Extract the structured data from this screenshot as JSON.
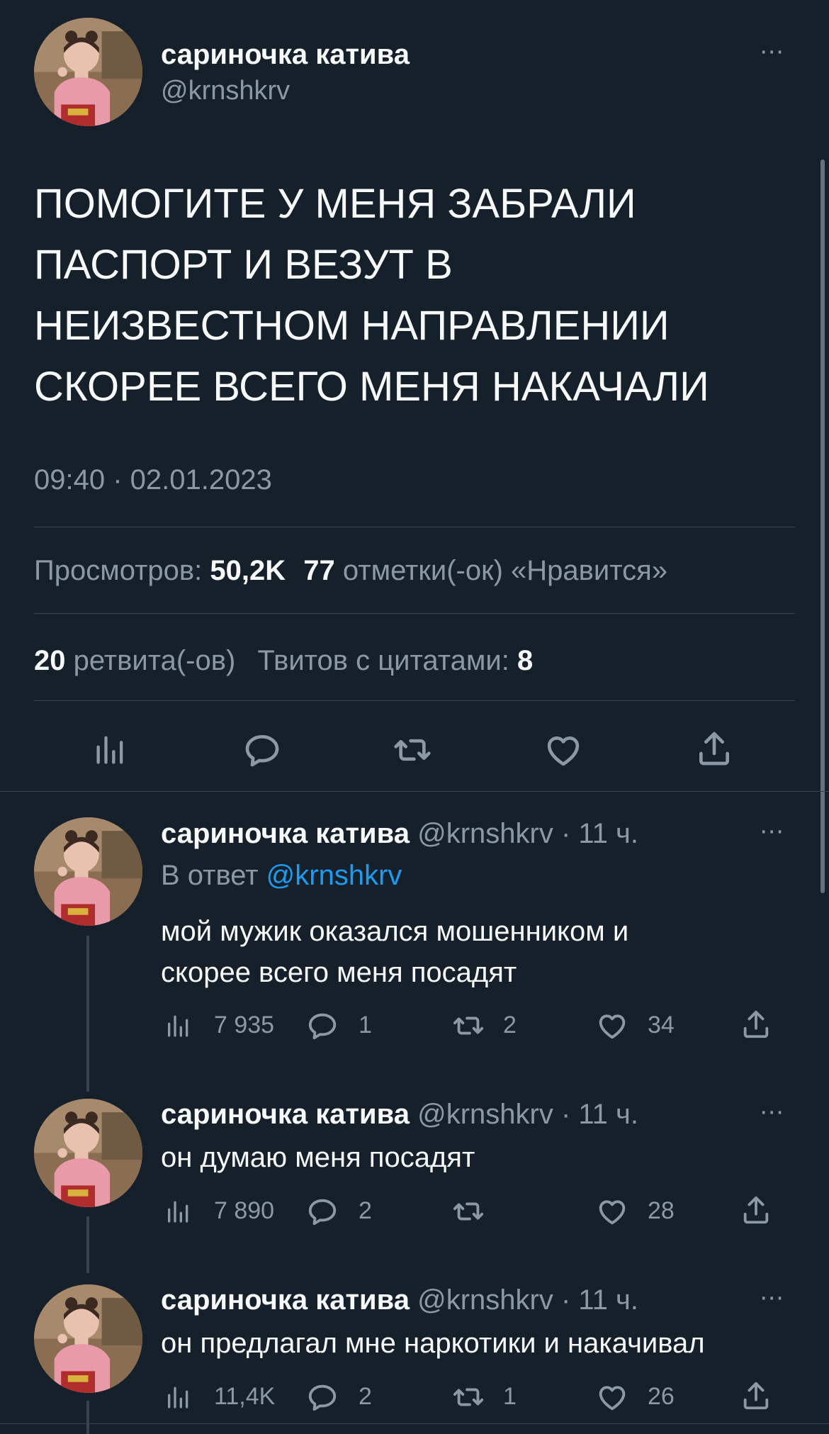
{
  "main_tweet": {
    "author_name": "сариночка катива",
    "author_handle": "@krnshkrv",
    "text_lines": [
      "ПОМОГИТЕ У МЕНЯ ЗАБРАЛИ",
      "ПАСПОРТ И ВЕЗУТ В",
      "НЕИЗВЕСТНОМ НАПРАВЛЕНИИ",
      "СКОРЕЕ ВСЕГО МЕНЯ НАКАЧАЛИ"
    ],
    "timestamp": "09:40 · 02.01.2023",
    "views_label": "Просмотров:",
    "views_value": "50,2K",
    "likes_value": "77",
    "likes_label": "отметки(-ок) «Нравится»",
    "retweets_value": "20",
    "retweets_label": "ретвита(-ов)",
    "quotes_label": "Твитов с цитатами:",
    "quotes_value": "8"
  },
  "replies": [
    {
      "author_name": "сариночка катива",
      "author_handle": "@krnshkrv",
      "time": "· 11 ч.",
      "reply_to_label": "В ответ",
      "reply_to_handle": "@krnshkrv",
      "text_lines": [
        "мой мужик оказался мошенником и",
        "скорее всего меня посадят"
      ],
      "views": "7 935",
      "replies": "1",
      "retweets": "2",
      "likes": "34"
    },
    {
      "author_name": "сариночка катива",
      "author_handle": "@krnshkrv",
      "time": "· 11 ч.",
      "text_lines": [
        "он думаю меня посадят"
      ],
      "views": "7 890",
      "replies": "2",
      "retweets": "",
      "likes": "28"
    },
    {
      "author_name": "сариночка катива",
      "author_handle": "@krnshkrv",
      "time": "· 11 ч.",
      "text_lines": [
        "он предлагал мне наркотики и накачивал"
      ],
      "views": "11,4K",
      "replies": "2",
      "retweets": "1",
      "likes": "26"
    }
  ],
  "more_icon": "⋯",
  "colors": {
    "background": "#15202b",
    "text": "#f7f9f9",
    "muted": "#8b98a5",
    "link": "#1d9bf0",
    "divider": "#38444d"
  }
}
